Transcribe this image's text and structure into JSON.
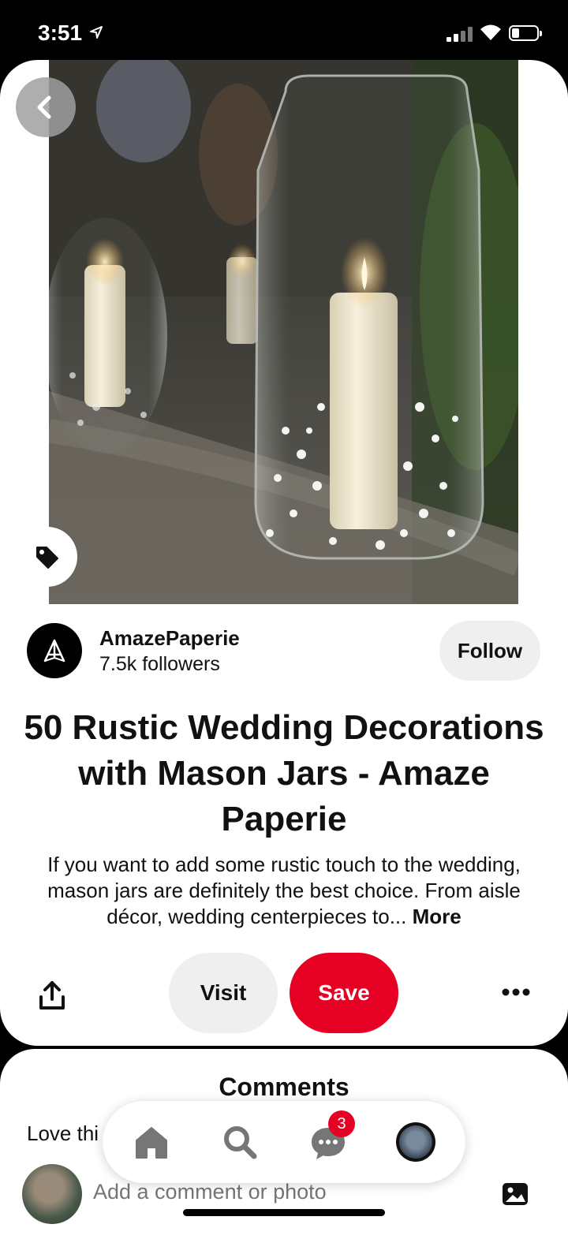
{
  "status_bar": {
    "time": "3:51",
    "location_icon": "location-arrow-icon",
    "signal_icon": "cellular-signal-icon",
    "wifi_icon": "wifi-icon",
    "battery_icon": "battery-icon"
  },
  "pin": {
    "image_subject": "glass-jar-candle-photo",
    "back_icon": "chevron-left-icon",
    "tag_icon": "price-tag-icon"
  },
  "profile": {
    "name": "AmazePaperie",
    "followers": "7.5k followers",
    "follow_label": "Follow",
    "avatar_icon": "amazepaperie-logo-icon"
  },
  "title": "50 Rustic Wedding Decorations with Mason Jars - Amaze Paperie",
  "description": {
    "text": "If you want to add some rustic touch to the wedding, mason jars are definitely the best choice. From aisle décor, wedding centerpieces to...",
    "more_label": "More"
  },
  "actions": {
    "share_icon": "share-icon",
    "visit_label": "Visit",
    "save_label": "Save",
    "more_icon": "ellipsis-icon"
  },
  "comments": {
    "title": "Comments",
    "preview_text": "Love thi",
    "input_placeholder": "Add a comment or photo",
    "photo_icon": "image-icon"
  },
  "bottom_nav": {
    "items": [
      {
        "icon": "home-icon"
      },
      {
        "icon": "search-icon"
      },
      {
        "icon": "messages-icon",
        "badge": "3"
      },
      {
        "icon": "profile-avatar"
      }
    ]
  },
  "colors": {
    "save_red": "#e60023",
    "button_gray": "#efefef"
  }
}
